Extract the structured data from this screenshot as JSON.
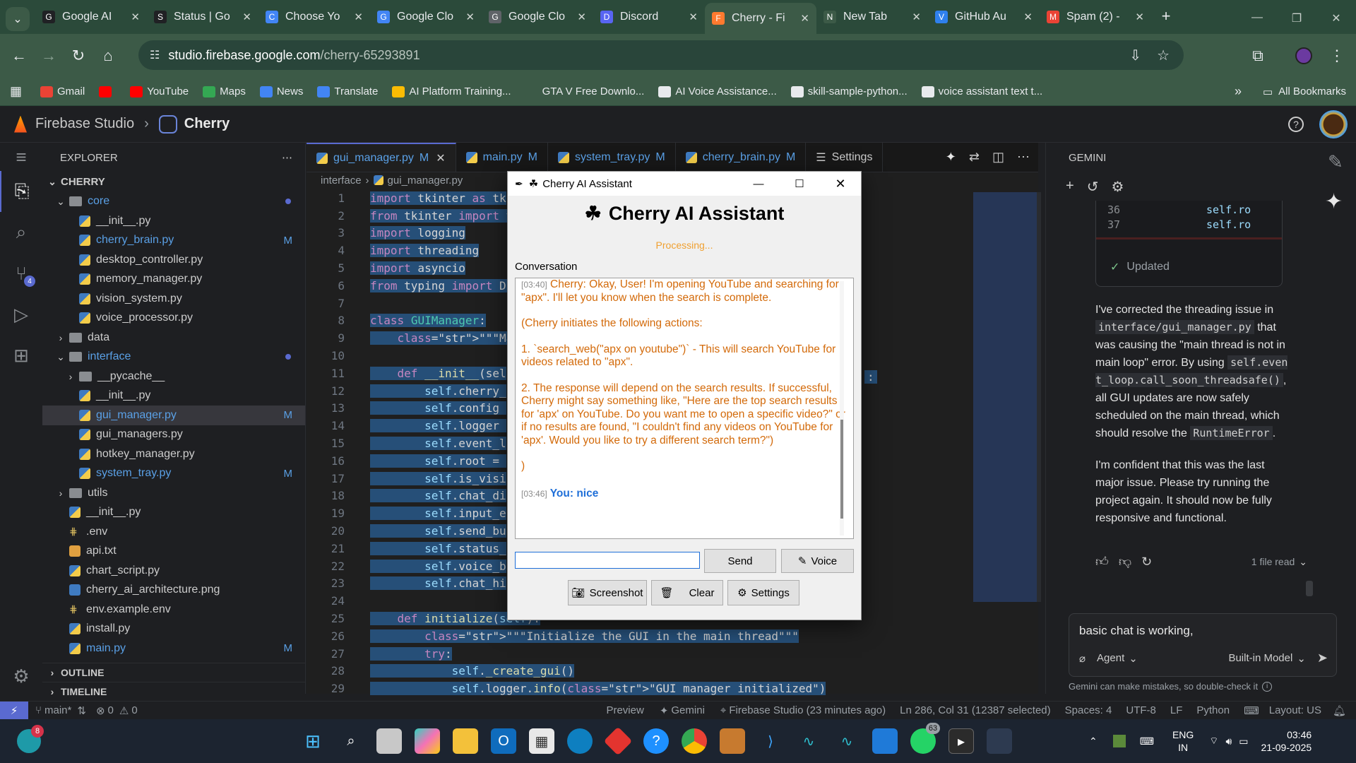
{
  "browser": {
    "tabs": [
      {
        "title": "Google AI",
        "color": "#202124",
        "icon": "G"
      },
      {
        "title": "Status | Go",
        "color": "#202124",
        "icon": "S"
      },
      {
        "title": "Choose Yo",
        "color": "#4285f4",
        "icon": "C"
      },
      {
        "title": "Google Clo",
        "color": "#4285f4",
        "icon": "G"
      },
      {
        "title": "Google Clo",
        "color": "#5f6368",
        "icon": "G"
      },
      {
        "title": "Discord",
        "color": "#5865f2",
        "icon": "D"
      },
      {
        "title": "Cherry - Fi",
        "color": "#ff7a2f",
        "icon": "F"
      },
      {
        "title": "New Tab",
        "color": "#3c5a47",
        "icon": "N"
      },
      {
        "title": "GitHub Au",
        "color": "#2f80ed",
        "icon": "V"
      },
      {
        "title": "Spam (2) -",
        "color": "#ea4335",
        "icon": "M"
      }
    ],
    "url_host": "studio.firebase.google.com",
    "url_path": "/cherry-65293891",
    "bookmarks": [
      {
        "label": "Gmail",
        "color": "#ea4335"
      },
      {
        "label": "",
        "color": "#ff0000"
      },
      {
        "label": "YouTube",
        "color": "#ff0000"
      },
      {
        "label": "Maps",
        "color": "#34a853"
      },
      {
        "label": "News",
        "color": "#4285f4"
      },
      {
        "label": "Translate",
        "color": "#4285f4"
      },
      {
        "label": "AI Platform Training...",
        "color": "#fbbc04"
      },
      {
        "label": "GTA V Free Downlo...",
        "color": "#3c5a47"
      },
      {
        "label": "AI Voice Assistance...",
        "color": "#e8eaed"
      },
      {
        "label": "skill-sample-python...",
        "color": "#e8eaed"
      },
      {
        "label": "voice assistant text t...",
        "color": "#e8eaed"
      }
    ],
    "all_bookmarks": "All Bookmarks"
  },
  "studio": {
    "brand": "Firebase Studio",
    "project": "Cherry"
  },
  "explorer": {
    "title": "EXPLORER",
    "root": "CHERRY",
    "rows": [
      {
        "label": "core",
        "kind": "folder-open",
        "indent": 1,
        "color": "#5aa0e6",
        "mark": "dot"
      },
      {
        "label": "__init__.py",
        "kind": "py",
        "indent": 2,
        "color": "#cccccc",
        "mark": ""
      },
      {
        "label": "cherry_brain.py",
        "kind": "py",
        "indent": 2,
        "color": "#5aa0e6",
        "mark": "M"
      },
      {
        "label": "desktop_controller.py",
        "kind": "py",
        "indent": 2,
        "color": "#cccccc",
        "mark": ""
      },
      {
        "label": "memory_manager.py",
        "kind": "py",
        "indent": 2,
        "color": "#cccccc",
        "mark": ""
      },
      {
        "label": "vision_system.py",
        "kind": "py",
        "indent": 2,
        "color": "#cccccc",
        "mark": ""
      },
      {
        "label": "voice_processor.py",
        "kind": "py",
        "indent": 2,
        "color": "#cccccc",
        "mark": ""
      },
      {
        "label": "data",
        "kind": "folder",
        "indent": 1,
        "color": "#cccccc",
        "mark": ""
      },
      {
        "label": "interface",
        "kind": "folder-open",
        "indent": 1,
        "color": "#5aa0e6",
        "mark": "dot"
      },
      {
        "label": "__pycache__",
        "kind": "folder",
        "indent": 2,
        "color": "#cccccc",
        "mark": ""
      },
      {
        "label": "__init__.py",
        "kind": "py",
        "indent": 2,
        "color": "#cccccc",
        "mark": ""
      },
      {
        "label": "gui_manager.py",
        "kind": "py",
        "indent": 2,
        "color": "#5aa0e6",
        "mark": "M",
        "sel": true
      },
      {
        "label": "gui_managers.py",
        "kind": "py",
        "indent": 2,
        "color": "#cccccc",
        "mark": ""
      },
      {
        "label": "hotkey_manager.py",
        "kind": "py",
        "indent": 2,
        "color": "#cccccc",
        "mark": ""
      },
      {
        "label": "system_tray.py",
        "kind": "py",
        "indent": 2,
        "color": "#5aa0e6",
        "mark": "M"
      },
      {
        "label": "utils",
        "kind": "folder",
        "indent": 1,
        "color": "#cccccc",
        "mark": ""
      },
      {
        "label": "__init__.py",
        "kind": "py",
        "indent": 1,
        "color": "#cccccc",
        "mark": ""
      },
      {
        "label": ".env",
        "kind": "cfg",
        "indent": 1,
        "color": "#cccccc",
        "mark": ""
      },
      {
        "label": "api.txt",
        "kind": "txt",
        "indent": 1,
        "color": "#cccccc",
        "mark": ""
      },
      {
        "label": "chart_script.py",
        "kind": "py",
        "indent": 1,
        "color": "#cccccc",
        "mark": ""
      },
      {
        "label": "cherry_ai_architecture.png",
        "kind": "img",
        "indent": 1,
        "color": "#cccccc",
        "mark": ""
      },
      {
        "label": "env.example.env",
        "kind": "cfg",
        "indent": 1,
        "color": "#cccccc",
        "mark": ""
      },
      {
        "label": "install.py",
        "kind": "py",
        "indent": 1,
        "color": "#cccccc",
        "mark": ""
      },
      {
        "label": "main.py",
        "kind": "py",
        "indent": 1,
        "color": "#5aa0e6",
        "mark": "M"
      }
    ],
    "outline": "OUTLINE",
    "timeline": "TIMELINE"
  },
  "editor": {
    "tabs": [
      {
        "label": "gui_manager.py",
        "mod": "M",
        "active": true
      },
      {
        "label": "main.py",
        "mod": "M",
        "active": false
      },
      {
        "label": "system_tray.py",
        "mod": "M",
        "active": false
      },
      {
        "label": "cherry_brain.py",
        "mod": "M",
        "active": false
      }
    ],
    "settings_tab": "Settings",
    "breadcrumb": [
      "interface",
      "gui_manager.py"
    ],
    "lines": [
      {
        "n": "1",
        "code": "import tkinter as tk"
      },
      {
        "n": "2",
        "code": "from tkinter import t"
      },
      {
        "n": "3",
        "code": "import logging"
      },
      {
        "n": "4",
        "code": "import threading"
      },
      {
        "n": "5",
        "code": "import asyncio"
      },
      {
        "n": "6",
        "code": "from typing import Di"
      },
      {
        "n": "7",
        "code": ""
      },
      {
        "n": "8",
        "code": "class GUIManager:"
      },
      {
        "n": "9",
        "code": "    \"\"\"Manages the Ch"
      },
      {
        "n": "10",
        "code": ""
      },
      {
        "n": "11",
        "code": "    def __init__(sel"
      },
      {
        "n": "12",
        "code": "        self.cherry_"
      },
      {
        "n": "13",
        "code": "        self.config "
      },
      {
        "n": "14",
        "code": "        self.logger "
      },
      {
        "n": "15",
        "code": "        self.event_l"
      },
      {
        "n": "16",
        "code": "        self.root = "
      },
      {
        "n": "17",
        "code": "        self.is_visi"
      },
      {
        "n": "18",
        "code": "        self.chat_di"
      },
      {
        "n": "19",
        "code": "        self.input_e"
      },
      {
        "n": "20",
        "code": "        self.send_bu"
      },
      {
        "n": "21",
        "code": "        self.status_"
      },
      {
        "n": "22",
        "code": "        self.voice_b"
      },
      {
        "n": "23",
        "code": "        self.chat_hi"
      },
      {
        "n": "24",
        "code": ""
      },
      {
        "n": "25",
        "code": "    def initialize(self):"
      },
      {
        "n": "26",
        "code": "        \"\"\"Initialize the GUI in the main thread\"\"\""
      },
      {
        "n": "27",
        "code": "        try:"
      },
      {
        "n": "28",
        "code": "            self._create_gui()"
      },
      {
        "n": "29",
        "code": "            self.logger.info(\"GUI manager initialized\")"
      }
    ],
    "line11_tail": ":"
  },
  "dialog": {
    "title": "Cherry AI Assistant",
    "heading": "Cherry AI Assistant",
    "status": "Processing...",
    "conversation_label": "Conversation",
    "messages": [
      {
        "ts": "[03:40]",
        "text": "Cherry: Okay, User!  I'm opening YouTube and searching for \"apx\".  I'll let you know when the search is complete."
      },
      {
        "ts": "",
        "text": "(Cherry initiates the following actions:"
      },
      {
        "ts": "",
        "text": "1.  `search_web(\"apx on youtube\")`  - This will search YouTube for videos related to \"apx\"."
      },
      {
        "ts": "",
        "text": "2.  The response will depend on the search results.  If successful, Cherry might say something like, \"Here are the top search results for 'apx' on YouTube.  Do you want me to open a specific video?\" or if no results are found, \"I couldn't find any videos on YouTube for 'apx'. Would you like to try a different search term?\")"
      },
      {
        "ts": "",
        "text": ")"
      }
    ],
    "user_ts": "[03:46]",
    "user_msg": "You: nice",
    "input_value": "",
    "send": "Send",
    "voice": "Voice",
    "screenshot": "Screenshot",
    "clear": "Clear",
    "settings": "Settings"
  },
  "gemini": {
    "title": "GEMINI",
    "diff_lines": [
      {
        "n": "36",
        "code": "self.ro"
      },
      {
        "n": "37",
        "code": "self.ro"
      }
    ],
    "updated": "Updated",
    "p1_a": "I've corrected the threading issue in",
    "p1_code1": "interface/gui_manager.py",
    "p1_b": "that was causing the \"main thread is not in main loop\" error. By using",
    "p1_code2": "self.event_loop.call_soon_threadsafe()",
    "p1_c": ", all GUI updates are now safely scheduled on the main thread, which should resolve the",
    "p1_code3": "RuntimeError",
    "p1_d": ".",
    "p2": "I'm confident that this was the last major issue. Please try running the project again. It should now be fully responsive and functional.",
    "files_read": "1 file read",
    "input": "basic chat is working,",
    "agent": "Agent",
    "model": "Built-in Model",
    "disclaimer": "Gemini can make mistakes, so double-check it"
  },
  "status": {
    "branch": "main*",
    "problems": "0",
    "warnings": "0",
    "preview": "Preview",
    "gemini": "Gemini",
    "studio": "Firebase Studio (23 minutes ago)",
    "position": "Ln 286, Col 31 (12387 selected)",
    "spaces": "Spaces: 4",
    "encoding": "UTF-8",
    "eol": "LF",
    "language": "Python",
    "layout": "Layout: US"
  },
  "taskbar": {
    "badge": "8",
    "lang": "ENG",
    "region": "IN",
    "time": "03:46",
    "date": "21-09-2025",
    "wa_badge": "63"
  }
}
